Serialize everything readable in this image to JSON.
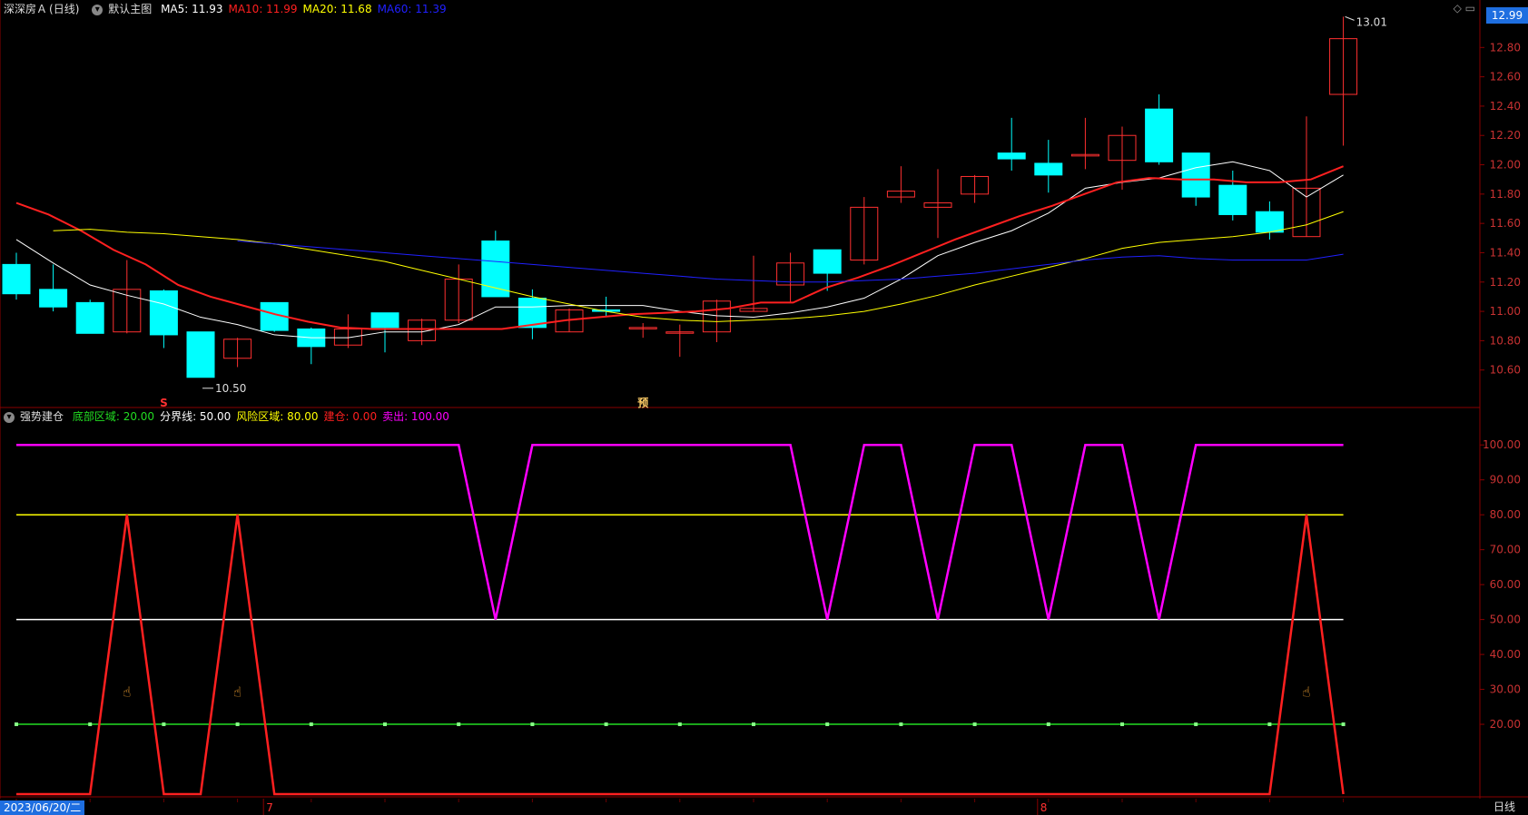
{
  "header": {
    "stock_name": "深深房Ａ",
    "period_tag": "(日线)",
    "template": "默认主图",
    "ma": [
      {
        "label": "MA5:",
        "value": "11.93",
        "color": "#ffffff"
      },
      {
        "label": "MA10:",
        "value": "11.99",
        "color": "#ff2020"
      },
      {
        "label": "MA20:",
        "value": "11.68",
        "color": "#ffff00"
      },
      {
        "label": "MA60:",
        "value": "11.39",
        "color": "#2020ff"
      }
    ],
    "current_price": "12.99"
  },
  "indicator_header": {
    "name": "强势建仓",
    "params": [
      {
        "label": "底部区域:",
        "value": "20.00",
        "color": "#22dd22"
      },
      {
        "label": "分界线:",
        "value": "50.00",
        "color": "#ffffff"
      },
      {
        "label": "风险区域:",
        "value": "80.00",
        "color": "#ffff00"
      },
      {
        "label": "建仓:",
        "value": "0.00",
        "color": "#ff2020"
      },
      {
        "label": "卖出:",
        "value": "100.00",
        "color": "#ff00ff"
      }
    ]
  },
  "footer": {
    "start_date": "2023/06/20/二",
    "period_button": "日线",
    "month_markers": [
      {
        "label": "7",
        "index": 7
      },
      {
        "label": "8",
        "index": 28
      }
    ]
  },
  "chart_data": [
    {
      "type": "candlestick",
      "title": "",
      "ylim": [
        10.4,
        13.0
      ],
      "yticks": [
        "12.80",
        "12.60",
        "12.40",
        "12.20",
        "12.00",
        "11.80",
        "11.60",
        "11.40",
        "11.20",
        "11.00",
        "10.80",
        "10.60"
      ],
      "max_label": "13.01",
      "min_label": "10.50",
      "up_color": "#ff3030",
      "down_color": "#00ffff",
      "candles": [
        {
          "o": 11.32,
          "h": 11.4,
          "l": 11.08,
          "c": 11.12
        },
        {
          "o": 11.15,
          "h": 11.32,
          "l": 11.0,
          "c": 11.03
        },
        {
          "o": 11.06,
          "h": 11.08,
          "l": 10.85,
          "c": 10.85
        },
        {
          "o": 10.86,
          "h": 11.35,
          "l": 10.85,
          "c": 11.15
        },
        {
          "o": 11.14,
          "h": 11.15,
          "l": 10.75,
          "c": 10.84
        },
        {
          "o": 10.86,
          "h": 10.86,
          "l": 10.55,
          "c": 10.55
        },
        {
          "o": 10.68,
          "h": 10.82,
          "l": 10.62,
          "c": 10.81
        },
        {
          "o": 11.06,
          "h": 11.06,
          "l": 10.86,
          "c": 10.87
        },
        {
          "o": 10.88,
          "h": 10.89,
          "l": 10.64,
          "c": 10.76
        },
        {
          "o": 10.77,
          "h": 10.98,
          "l": 10.75,
          "c": 10.88
        },
        {
          "o": 10.99,
          "h": 10.99,
          "l": 10.72,
          "c": 10.89
        },
        {
          "o": 10.8,
          "h": 10.95,
          "l": 10.77,
          "c": 10.94
        },
        {
          "o": 10.94,
          "h": 11.32,
          "l": 10.92,
          "c": 11.22
        },
        {
          "o": 11.48,
          "h": 11.55,
          "l": 11.1,
          "c": 11.1
        },
        {
          "o": 11.09,
          "h": 11.15,
          "l": 10.81,
          "c": 10.89
        },
        {
          "o": 10.86,
          "h": 11.02,
          "l": 10.86,
          "c": 11.01
        },
        {
          "o": 11.01,
          "h": 11.1,
          "l": 10.96,
          "c": 11.0
        },
        {
          "o": 10.89,
          "h": 10.92,
          "l": 10.82,
          "c": 10.89
        },
        {
          "o": 10.86,
          "h": 10.91,
          "l": 10.69,
          "c": 10.86
        },
        {
          "o": 10.86,
          "h": 11.08,
          "l": 10.79,
          "c": 11.07
        },
        {
          "o": 11.0,
          "h": 11.38,
          "l": 11.0,
          "c": 11.02
        },
        {
          "o": 11.18,
          "h": 11.4,
          "l": 11.06,
          "c": 11.33
        },
        {
          "o": 11.42,
          "h": 11.42,
          "l": 11.14,
          "c": 11.26
        },
        {
          "o": 11.35,
          "h": 11.78,
          "l": 11.32,
          "c": 11.71
        },
        {
          "o": 11.78,
          "h": 11.99,
          "l": 11.74,
          "c": 11.82
        },
        {
          "o": 11.71,
          "h": 11.97,
          "l": 11.5,
          "c": 11.74
        },
        {
          "o": 11.8,
          "h": 11.93,
          "l": 11.74,
          "c": 11.92
        },
        {
          "o": 12.08,
          "h": 12.32,
          "l": 11.96,
          "c": 12.04
        },
        {
          "o": 12.01,
          "h": 12.17,
          "l": 11.81,
          "c": 11.93
        },
        {
          "o": 12.06,
          "h": 12.32,
          "l": 11.97,
          "c": 12.07
        },
        {
          "o": 12.03,
          "h": 12.26,
          "l": 11.83,
          "c": 12.2
        },
        {
          "o": 12.38,
          "h": 12.48,
          "l": 12.0,
          "c": 12.02
        },
        {
          "o": 12.08,
          "h": 12.08,
          "l": 11.72,
          "c": 11.78
        },
        {
          "o": 11.86,
          "h": 11.96,
          "l": 11.62,
          "c": 11.66
        },
        {
          "o": 11.68,
          "h": 11.75,
          "l": 11.49,
          "c": 11.54
        },
        {
          "o": 11.51,
          "h": 12.33,
          "l": 11.51,
          "c": 11.84
        },
        {
          "o": 12.48,
          "h": 13.01,
          "l": 12.13,
          "c": 12.86
        }
      ],
      "series": [
        {
          "name": "MA5",
          "color": "#ffffff",
          "values": [
            11.49,
            11.33,
            11.18,
            11.11,
            11.05,
            10.96,
            10.91,
            10.84,
            10.82,
            10.82,
            10.86,
            10.86,
            10.91,
            11.03,
            11.03,
            11.04,
            11.04,
            11.04,
            11.0,
            10.97,
            10.96,
            10.99,
            11.03,
            11.09,
            11.22,
            11.38,
            11.47,
            11.55,
            11.67,
            11.84,
            11.88,
            11.91,
            11.98,
            12.02,
            11.96,
            11.78,
            11.93
          ]
        },
        {
          "name": "MA10",
          "color": "#ff2020",
          "values": [
            11.74,
            11.66,
            11.55,
            11.42,
            11.32,
            11.18,
            11.1,
            11.04,
            10.98,
            10.93,
            10.89,
            10.88,
            10.88,
            10.88,
            10.88,
            10.88,
            10.91,
            10.94,
            10.96,
            10.98,
            10.99,
            11.0,
            11.02,
            11.06,
            11.06,
            11.16,
            11.23,
            11.31,
            11.4,
            11.49,
            11.57,
            11.65,
            11.72,
            11.8,
            11.88,
            11.91,
            11.9,
            11.9,
            11.88,
            11.88,
            11.9,
            11.99
          ]
        },
        {
          "name": "MA20",
          "color": "#ffff00",
          "values": [
            11.55,
            11.56,
            11.54,
            11.53,
            11.51,
            11.49,
            11.46,
            11.42,
            11.38,
            11.34,
            11.28,
            11.22,
            11.16,
            11.1,
            11.05,
            11.0,
            10.96,
            10.94,
            10.93,
            10.94,
            10.95,
            10.97,
            11.0,
            11.05,
            11.11,
            11.18,
            11.24,
            11.3,
            11.36,
            11.43,
            11.47,
            11.49,
            11.51,
            11.54,
            11.59,
            11.68
          ]
        },
        {
          "name": "MA60",
          "color": "#2020ff",
          "values": [
            11.48,
            11.46,
            11.44,
            11.42,
            11.4,
            11.38,
            11.36,
            11.34,
            11.32,
            11.3,
            11.28,
            11.26,
            11.24,
            11.22,
            11.21,
            11.2,
            11.2,
            11.21,
            11.22,
            11.24,
            11.26,
            11.29,
            11.32,
            11.35,
            11.37,
            11.38,
            11.36,
            11.35,
            11.35,
            11.35,
            11.39
          ]
        }
      ],
      "markers": [
        {
          "label": "S",
          "index": 4
        },
        {
          "label": "预",
          "index": 17
        }
      ]
    },
    {
      "type": "line",
      "title": "",
      "ylim": [
        0,
        105
      ],
      "yticks": [
        "100.00",
        "90.00",
        "80.00",
        "70.00",
        "60.00",
        "50.00",
        "40.00",
        "30.00",
        "20.00"
      ],
      "series": [
        {
          "name": "底部区域",
          "color": "#22dd22",
          "values": [
            20,
            20
          ]
        },
        {
          "name": "分界线",
          "color": "#ffffff",
          "values": [
            50,
            50
          ]
        },
        {
          "name": "风险区域",
          "color": "#ffff00",
          "values": [
            80,
            80
          ]
        },
        {
          "name": "建仓",
          "color": "#ff2020",
          "values": [
            0,
            0,
            0,
            80,
            0,
            0,
            80,
            0,
            0,
            0,
            0,
            0,
            0,
            0,
            0,
            0,
            0,
            0,
            0,
            0,
            0,
            0,
            0,
            0,
            0,
            0,
            0,
            0,
            0,
            0,
            0,
            0,
            0,
            0,
            0,
            80,
            0
          ]
        },
        {
          "name": "卖出",
          "color": "#ff00ff",
          "values": [
            100,
            100,
            100,
            100,
            100,
            100,
            100,
            100,
            100,
            100,
            100,
            100,
            100,
            50,
            100,
            100,
            100,
            100,
            100,
            100,
            100,
            100,
            50,
            100,
            100,
            50,
            100,
            100,
            50,
            100,
            100,
            50,
            100,
            100,
            100,
            100,
            100
          ]
        }
      ],
      "hand_markers": [
        3,
        6,
        35
      ]
    }
  ]
}
